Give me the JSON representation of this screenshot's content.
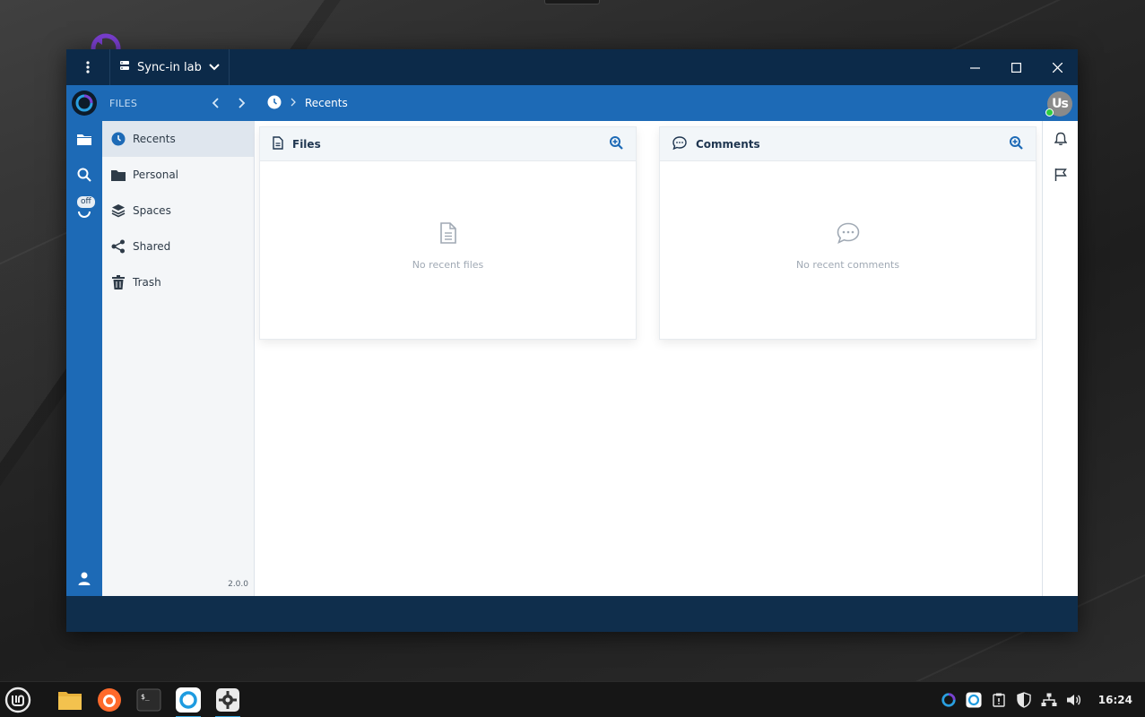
{
  "window": {
    "server_name": "Sync-in lab"
  },
  "topbar": {
    "section_label": "FILES",
    "breadcrumb": "Recents",
    "avatar_initials": "Us"
  },
  "rail": {
    "sync_badge": "off"
  },
  "sidebar": {
    "items": [
      {
        "label": "Recents",
        "icon": "clock-icon",
        "active": true
      },
      {
        "label": "Personal",
        "icon": "folder-icon",
        "active": false
      },
      {
        "label": "Spaces",
        "icon": "layers-icon",
        "active": false
      },
      {
        "label": "Shared",
        "icon": "share-icon",
        "active": false
      },
      {
        "label": "Trash",
        "icon": "trash-icon",
        "active": false
      }
    ],
    "version": "2.0.0"
  },
  "cards": {
    "files": {
      "title": "Files",
      "empty_text": "No recent files"
    },
    "comments": {
      "title": "Comments",
      "empty_text": "No recent comments"
    }
  },
  "taskbar": {
    "apps": [
      "mint-menu",
      "file-manager",
      "firefox",
      "terminal",
      "sync-in",
      "settings"
    ],
    "clock": "16:24"
  },
  "colors": {
    "accent": "#1d6ab6",
    "titlebar": "#0c2a49",
    "sidebar_bg": "#f4f6f8"
  }
}
